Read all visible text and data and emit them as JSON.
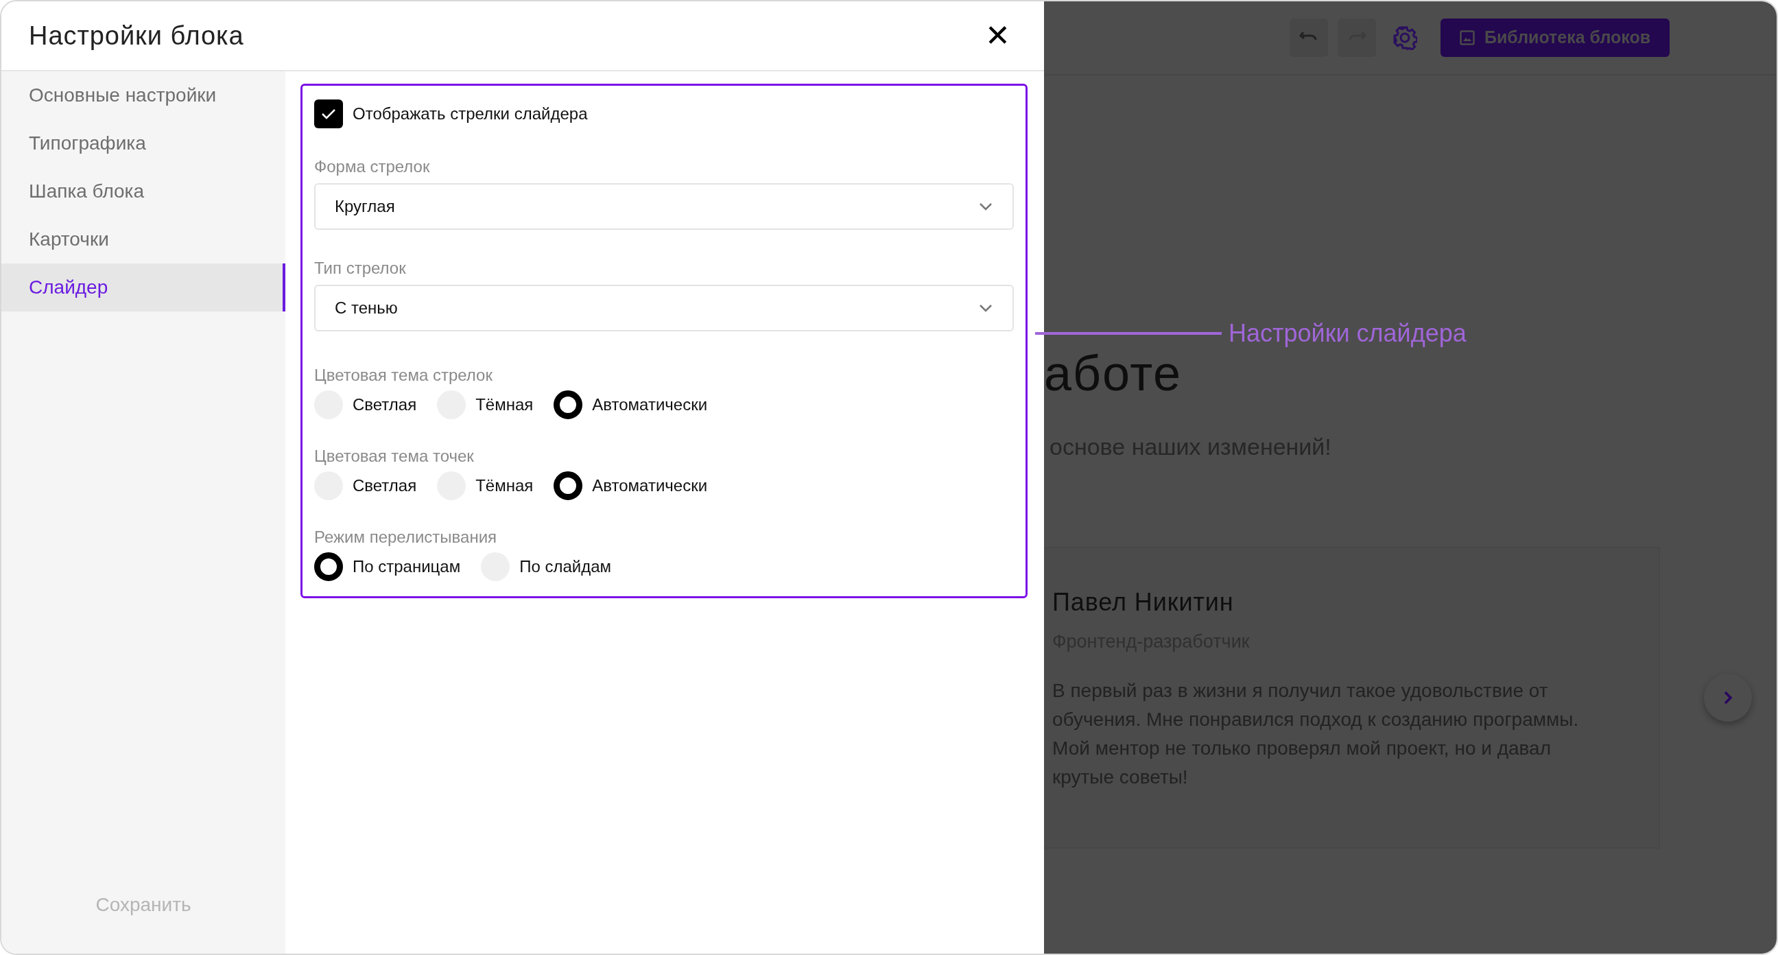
{
  "dialog": {
    "title": "Настройки блока",
    "close": "✕"
  },
  "sidebar": {
    "items": [
      {
        "label": "Основные настройки",
        "selected": false
      },
      {
        "label": "Типографика",
        "selected": false
      },
      {
        "label": "Шапка блока",
        "selected": false
      },
      {
        "label": "Карточки",
        "selected": false
      },
      {
        "label": "Слайдер",
        "selected": true
      }
    ],
    "save": "Сохранить"
  },
  "form": {
    "show_arrows": {
      "label": "Отображать стрелки слайдера",
      "checked": true
    },
    "selects": [
      {
        "label": "Форма стрелок",
        "value": "Круглая"
      },
      {
        "label": "Тип стрелок",
        "value": "С тенью"
      }
    ],
    "radio_groups": [
      {
        "label": "Цветовая тема стрелок",
        "options": [
          {
            "label": "Светлая",
            "selected": false
          },
          {
            "label": "Тёмная",
            "selected": false
          },
          {
            "label": "Автоматически",
            "selected": true
          }
        ]
      },
      {
        "label": "Цветовая тема точек",
        "options": [
          {
            "label": "Светлая",
            "selected": false
          },
          {
            "label": "Тёмная",
            "selected": false
          },
          {
            "label": "Автоматически",
            "selected": true
          }
        ]
      },
      {
        "label": "Режим перелистывания",
        "options": [
          {
            "label": "По страницам",
            "selected": true
          },
          {
            "label": "По слайдам",
            "selected": false
          }
        ]
      }
    ]
  },
  "annotation": "Настройки слайдера",
  "background": {
    "library_button": "Библиотека блоков",
    "heading": "аботе",
    "subtitle": "основе наших изменений!",
    "card": {
      "name": "Павел Никитин",
      "role": "Фронтенд-разработчик",
      "text": "В первый раз в жизни я получил такое удовольствие от обучения. Мне понравился подход к созданию программы. Мой ментор не только проверял мой проект, но и давал крутые советы!"
    }
  }
}
